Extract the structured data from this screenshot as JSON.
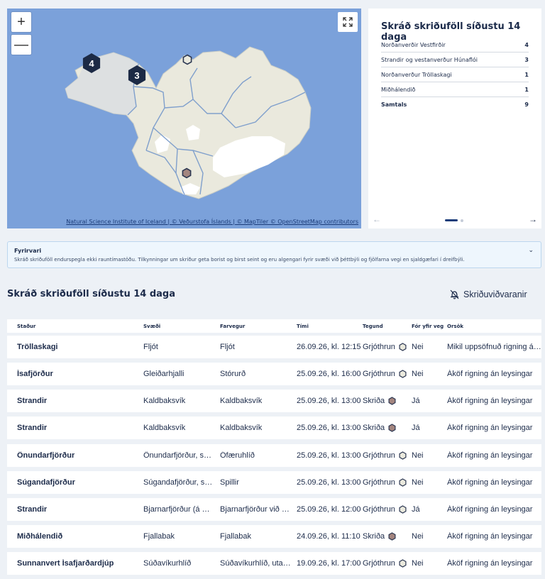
{
  "map": {
    "zoom_in": "+",
    "zoom_out": "—",
    "fullscreen_icon": "fullscreen-icon",
    "cluster_markers": [
      "4",
      "3"
    ],
    "attribution": "Natural Science Institute of Iceland | © Veðurstofa Íslands | © MapTiler © OpenStreetMap contributors",
    "colors": {
      "water": "#7ba1da",
      "land": "#eae9dd",
      "glacier": "#ffffff",
      "boundary": "#7f9fcc",
      "cluster": "#1c2a45"
    }
  },
  "summary": {
    "title": "Skráð skriðuföll síðustu 14 daga",
    "rows": [
      {
        "region": "Norðanverðir Vestfirðir",
        "count": "4"
      },
      {
        "region": "Strandir og vestanverður Húnaflói",
        "count": "3"
      },
      {
        "region": "Norðanverður Tröllaskagi",
        "count": "1"
      },
      {
        "region": "Miðhálendið",
        "count": "1"
      }
    ],
    "total_label": "Samtals",
    "total_count": "9",
    "prev_icon": "←",
    "next_icon": "→"
  },
  "notice": {
    "title": "Fyrirvari",
    "text": "Skráð skriðuföll endurspegla ekki rauntímastöðu. Tilkynningar um skriður geta borist og birst seint og eru algengari fyrir svæði við þéttbýli og fjölfarna vegi en sjaldgæfari í dreifbýli.",
    "chevron": "⌄"
  },
  "section": {
    "title": "Skráð skriðuföll síðustu 14 daga",
    "warnings_link": "Skriðuviðvaranir"
  },
  "table": {
    "headers": [
      "Staður",
      "Svæði",
      "Farvegur",
      "Tími",
      "Tegund",
      "Fór yfir veg",
      "Orsök"
    ],
    "rows": [
      {
        "place": "Tröllaskagi",
        "area": "Fljót",
        "path": "Fljót",
        "time": "26.09.26, kl. 12:15",
        "type": "Grjóthrun",
        "road": "Nei",
        "cause": "Mikil uppsöfnuð rigning án leysingar"
      },
      {
        "place": "Ísafjörður",
        "area": "Gleiðarhjalli",
        "path": "Stórurð",
        "time": "25.09.26, kl. 16:00",
        "type": "Grjóthrun",
        "road": "Nei",
        "cause": "Áköf rigning án leysingar"
      },
      {
        "place": "Strandir",
        "area": "Kaldbaksvík",
        "path": "Kaldbaksvík",
        "time": "25.09.26, kl. 13:00",
        "type": "Skriða",
        "road": "Já",
        "cause": "Áköf rigning án leysingar"
      },
      {
        "place": "Strandir",
        "area": "Kaldbaksvík",
        "path": "Kaldbaksvík",
        "time": "25.09.26, kl. 13:00",
        "type": "Skriða",
        "road": "Já",
        "cause": "Áköf rigning án leysingar"
      },
      {
        "place": "Önundarfjörður",
        "area": "Önundarfjörður, sunnanverður",
        "path": "Ófæruhlíð",
        "time": "25.09.26, kl. 13:00",
        "type": "Grjóthrun",
        "road": "Nei",
        "cause": "Áköf rigning án leysingar"
      },
      {
        "place": "Súgandafjörður",
        "area": "Súgandafjörður, sunnanverður",
        "path": "Spillir",
        "time": "25.09.26, kl. 13:00",
        "type": "Grjóthrun",
        "road": "Nei",
        "cause": "Áköf rigning án leysingar"
      },
      {
        "place": "Strandir",
        "area": "Bjarnarfjörður (á Ströndum)",
        "path": "Bjarnarfjörður við Drangsnes",
        "time": "25.09.26, kl. 12:00",
        "type": "Grjóthrun",
        "road": "Já",
        "cause": "Áköf rigning án leysingar"
      },
      {
        "place": "Miðhálendið",
        "area": "Fjallabak",
        "path": "Fjallabak",
        "time": "24.09.26, kl. 11:10",
        "type": "Skriða",
        "road": "Nei",
        "cause": "Áköf rigning án leysingar"
      },
      {
        "place": "Sunnanvert Ísafjarðardjúp",
        "area": "Súðavíkurhlíð",
        "path": "Súðavíkurhlíð, utan við Súðavík",
        "time": "19.09.26, kl. 17:00",
        "type": "Grjóthrun",
        "road": "Nei",
        "cause": "Áköf rigning án leysingar"
      }
    ]
  }
}
